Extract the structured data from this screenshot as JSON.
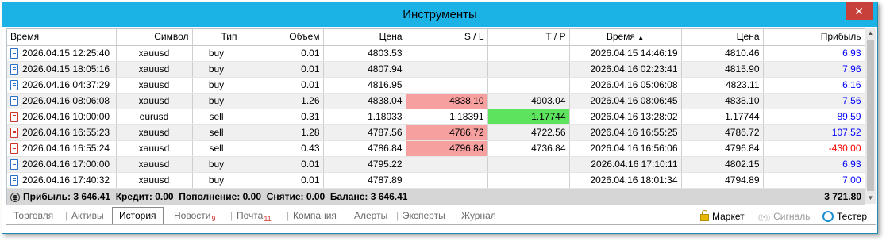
{
  "window": {
    "title": "Инструменты",
    "close_label": "✕"
  },
  "table": {
    "columns": [
      "Время",
      "Символ",
      "Тип",
      "Объем",
      "Цена",
      "S / L",
      "T / P",
      "Время",
      "Цена",
      "Прибыль"
    ],
    "sort_indicator": "▲",
    "rows": [
      {
        "open_time": "2026.04.15 12:25:40",
        "symbol": "xauusd",
        "type": "buy",
        "volume": "0.01",
        "price": "4803.53",
        "sl": "",
        "tp": "",
        "close_time": "2026.04.15 14:46:19",
        "close_price": "4810.46",
        "profit": "6.93",
        "profit_sign": "pos",
        "sl_hit": false,
        "tp_hit": false
      },
      {
        "open_time": "2026.04.15 18:05:16",
        "symbol": "xauusd",
        "type": "buy",
        "volume": "0.01",
        "price": "4807.94",
        "sl": "",
        "tp": "",
        "close_time": "2026.04.16 02:23:41",
        "close_price": "4815.90",
        "profit": "7.96",
        "profit_sign": "pos",
        "sl_hit": false,
        "tp_hit": false
      },
      {
        "open_time": "2026.04.16 04:37:29",
        "symbol": "xauusd",
        "type": "buy",
        "volume": "0.01",
        "price": "4816.95",
        "sl": "",
        "tp": "",
        "close_time": "2026.04.16 05:06:08",
        "close_price": "4823.11",
        "profit": "6.16",
        "profit_sign": "pos",
        "sl_hit": false,
        "tp_hit": false
      },
      {
        "open_time": "2026.04.16 08:06:08",
        "symbol": "xauusd",
        "type": "buy",
        "volume": "1.26",
        "price": "4838.04",
        "sl": "4838.10",
        "tp": "4903.04",
        "close_time": "2026.04.16 08:06:45",
        "close_price": "4838.10",
        "profit": "7.56",
        "profit_sign": "pos",
        "sl_hit": true,
        "tp_hit": false
      },
      {
        "open_time": "2026.04.16 10:00:00",
        "symbol": "eurusd",
        "type": "sell",
        "volume": "0.31",
        "price": "1.18033",
        "sl": "1.18391",
        "tp": "1.17744",
        "close_time": "2026.04.16 13:28:02",
        "close_price": "1.17744",
        "profit": "89.59",
        "profit_sign": "pos",
        "sl_hit": false,
        "tp_hit": true
      },
      {
        "open_time": "2026.04.16 16:55:23",
        "symbol": "xauusd",
        "type": "sell",
        "volume": "1.28",
        "price": "4787.56",
        "sl": "4786.72",
        "tp": "4722.56",
        "close_time": "2026.04.16 16:55:25",
        "close_price": "4786.72",
        "profit": "107.52",
        "profit_sign": "pos",
        "sl_hit": true,
        "tp_hit": false
      },
      {
        "open_time": "2026.04.16 16:55:24",
        "symbol": "xauusd",
        "type": "sell",
        "volume": "0.43",
        "price": "4786.84",
        "sl": "4796.84",
        "tp": "4736.84",
        "close_time": "2026.04.16 16:56:06",
        "close_price": "4796.84",
        "profit": "-430.00",
        "profit_sign": "neg",
        "sl_hit": true,
        "tp_hit": false
      },
      {
        "open_time": "2026.04.16 17:00:00",
        "symbol": "xauusd",
        "type": "buy",
        "volume": "0.01",
        "price": "4795.22",
        "sl": "",
        "tp": "",
        "close_time": "2026.04.16 17:10:11",
        "close_price": "4802.15",
        "profit": "6.93",
        "profit_sign": "pos",
        "sl_hit": false,
        "tp_hit": false
      },
      {
        "open_time": "2026.04.16 17:40:32",
        "symbol": "xauusd",
        "type": "buy",
        "volume": "0.01",
        "price": "4787.89",
        "sl": "",
        "tp": "",
        "close_time": "2026.04.16 18:01:34",
        "close_price": "4794.89",
        "profit": "7.00",
        "profit_sign": "pos",
        "sl_hit": false,
        "tp_hit": false
      }
    ],
    "summary": {
      "icon": "⊕",
      "text": "Прибыль: 3 646.41  Кредит: 0.00  Пополнение: 0.00  Снятие: 0.00  Баланс: 3 646.41",
      "total": "3 721.80"
    }
  },
  "tabs": [
    {
      "label": "Торговля",
      "badge": "",
      "active": false
    },
    {
      "label": "Активы",
      "badge": "",
      "active": false
    },
    {
      "label": "История",
      "badge": "",
      "active": true
    },
    {
      "label": "Новости",
      "badge": "9",
      "active": false
    },
    {
      "label": "Почта",
      "badge": "11",
      "active": false
    },
    {
      "label": "Компания",
      "badge": "",
      "active": false
    },
    {
      "label": "Алерты",
      "badge": "",
      "active": false
    },
    {
      "label": "Эксперты",
      "badge": "",
      "active": false
    },
    {
      "label": "Журнал",
      "badge": "",
      "active": false
    }
  ],
  "right_tools": {
    "market": "Маркет",
    "signals": "Сигналы",
    "signals_icon": "((•))",
    "tester": "Тестер"
  }
}
